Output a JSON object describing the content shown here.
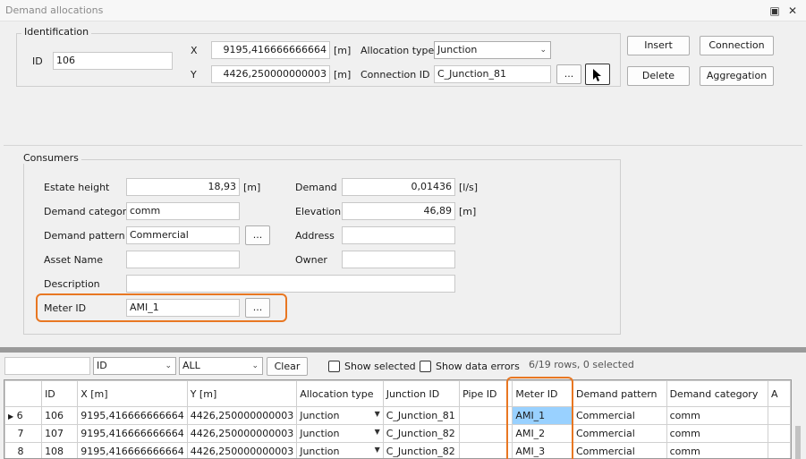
{
  "window": {
    "title": "Demand allocations"
  },
  "identification": {
    "group_label": "Identification",
    "id_label": "ID",
    "id_value": "106",
    "x_label": "X",
    "x_value": "9195,416666666664",
    "x_unit": "[m]",
    "y_label": "Y",
    "y_value": "4426,250000000003",
    "y_unit": "[m]",
    "allocation_type_label": "Allocation type",
    "allocation_type_value": "Junction",
    "connection_id_label": "Connection ID",
    "connection_id_value": "C_Junction_81",
    "ellipsis": "...",
    "insert_label": "Insert",
    "delete_label": "Delete",
    "connection_label": "Connection",
    "aggregation_label": "Aggregation"
  },
  "consumers": {
    "group_label": "Consumers",
    "estate_height_label": "Estate height",
    "estate_height_value": "18,93",
    "estate_height_unit": "[m]",
    "demand_label": "Demand",
    "demand_value": "0,01436",
    "demand_unit": "[l/s]",
    "demand_category_label": "Demand category",
    "demand_category_value": "comm",
    "elevation_label": "Elevation",
    "elevation_value": "46,89",
    "elevation_unit": "[m]",
    "demand_pattern_label": "Demand pattern",
    "demand_pattern_value": "Commercial",
    "address_label": "Address",
    "address_value": "",
    "asset_name_label": "Asset Name",
    "asset_name_value": "",
    "owner_label": "Owner",
    "owner_value": "",
    "description_label": "Description",
    "description_value": "",
    "meter_id_label": "Meter ID",
    "meter_id_value": "AMI_1",
    "ellipsis": "..."
  },
  "toolbar": {
    "search_value": "",
    "column_select": "ID",
    "filter_select": "ALL",
    "clear_label": "Clear",
    "show_selected_label": "Show selected",
    "show_errors_label": "Show data errors",
    "status": "6/19 rows, 0 selected"
  },
  "table": {
    "columns": [
      "",
      "ID",
      "X [m]",
      "Y [m]",
      "Allocation type",
      "Junction ID",
      "Pipe ID",
      "Meter ID",
      "Demand pattern",
      "Demand category",
      "A"
    ],
    "rows": [
      {
        "rownum": "6",
        "id": "106",
        "x": "9195,416666666664",
        "y": "4426,250000000003",
        "alloc": "Junction",
        "junction": "C_Junction_81",
        "pipe": "",
        "meter": "AMI_1",
        "pattern": "Commercial",
        "category": "comm"
      },
      {
        "rownum": "7",
        "id": "107",
        "x": "9195,416666666664",
        "y": "4426,250000000003",
        "alloc": "Junction",
        "junction": "C_Junction_82",
        "pipe": "",
        "meter": "AMI_2",
        "pattern": "Commercial",
        "category": "comm"
      },
      {
        "rownum": "8",
        "id": "108",
        "x": "9195,416666666664",
        "y": "4426,250000000003",
        "alloc": "Junction",
        "junction": "C_Junction_82",
        "pipe": "",
        "meter": "AMI_3",
        "pattern": "Commercial",
        "category": "comm"
      }
    ]
  },
  "colors": {
    "highlight": "#e87722",
    "selected_cell": "#99d1ff"
  }
}
